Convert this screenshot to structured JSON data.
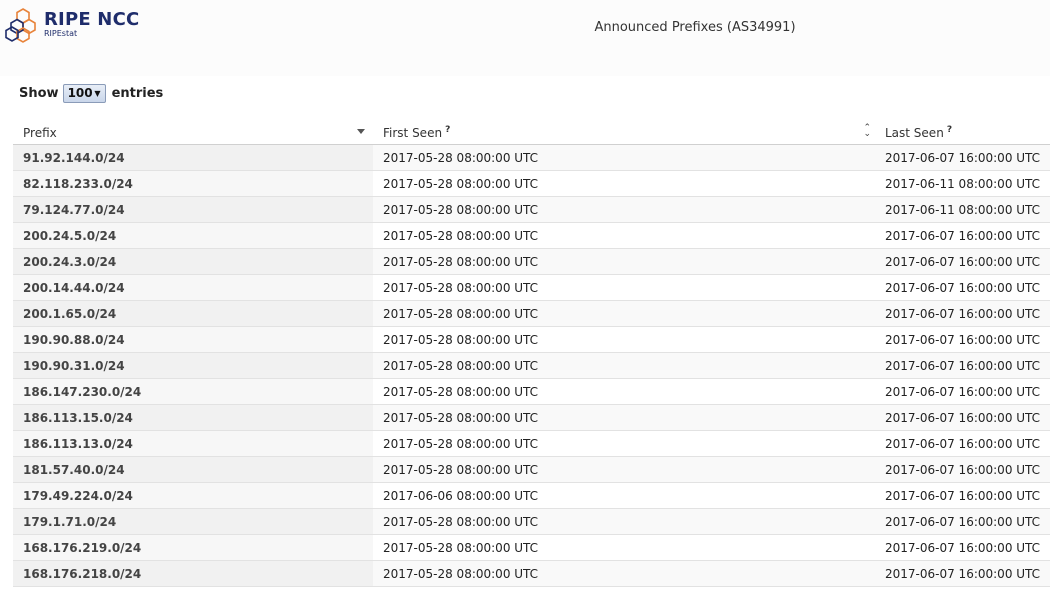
{
  "header": {
    "brand": "RIPE NCC",
    "product": "RIPEstat",
    "widget_title": "Announced Prefixes (AS34991)"
  },
  "length_menu": {
    "show_label": "Show",
    "selected": "100",
    "entries_label": "entries"
  },
  "table": {
    "columns": [
      {
        "label": "Prefix",
        "help": ""
      },
      {
        "label": "First Seen",
        "help": "?"
      },
      {
        "label": "Last Seen",
        "help": "?"
      }
    ],
    "rows": [
      {
        "prefix": "91.92.144.0/24",
        "first_seen": "2017-05-28 08:00:00 UTC",
        "last_seen": "2017-06-07 16:00:00 UTC"
      },
      {
        "prefix": "82.118.233.0/24",
        "first_seen": "2017-05-28 08:00:00 UTC",
        "last_seen": "2017-06-11 08:00:00 UTC"
      },
      {
        "prefix": "79.124.77.0/24",
        "first_seen": "2017-05-28 08:00:00 UTC",
        "last_seen": "2017-06-11 08:00:00 UTC"
      },
      {
        "prefix": "200.24.5.0/24",
        "first_seen": "2017-05-28 08:00:00 UTC",
        "last_seen": "2017-06-07 16:00:00 UTC"
      },
      {
        "prefix": "200.24.3.0/24",
        "first_seen": "2017-05-28 08:00:00 UTC",
        "last_seen": "2017-06-07 16:00:00 UTC"
      },
      {
        "prefix": "200.14.44.0/24",
        "first_seen": "2017-05-28 08:00:00 UTC",
        "last_seen": "2017-06-07 16:00:00 UTC"
      },
      {
        "prefix": "200.1.65.0/24",
        "first_seen": "2017-05-28 08:00:00 UTC",
        "last_seen": "2017-06-07 16:00:00 UTC"
      },
      {
        "prefix": "190.90.88.0/24",
        "first_seen": "2017-05-28 08:00:00 UTC",
        "last_seen": "2017-06-07 16:00:00 UTC"
      },
      {
        "prefix": "190.90.31.0/24",
        "first_seen": "2017-05-28 08:00:00 UTC",
        "last_seen": "2017-06-07 16:00:00 UTC"
      },
      {
        "prefix": "186.147.230.0/24",
        "first_seen": "2017-05-28 08:00:00 UTC",
        "last_seen": "2017-06-07 16:00:00 UTC"
      },
      {
        "prefix": "186.113.15.0/24",
        "first_seen": "2017-05-28 08:00:00 UTC",
        "last_seen": "2017-06-07 16:00:00 UTC"
      },
      {
        "prefix": "186.113.13.0/24",
        "first_seen": "2017-05-28 08:00:00 UTC",
        "last_seen": "2017-06-07 16:00:00 UTC"
      },
      {
        "prefix": "181.57.40.0/24",
        "first_seen": "2017-05-28 08:00:00 UTC",
        "last_seen": "2017-06-07 16:00:00 UTC"
      },
      {
        "prefix": "179.49.224.0/24",
        "first_seen": "2017-06-06 08:00:00 UTC",
        "last_seen": "2017-06-07 16:00:00 UTC"
      },
      {
        "prefix": "179.1.71.0/24",
        "first_seen": "2017-05-28 08:00:00 UTC",
        "last_seen": "2017-06-07 16:00:00 UTC"
      },
      {
        "prefix": "168.176.219.0/24",
        "first_seen": "2017-05-28 08:00:00 UTC",
        "last_seen": "2017-06-07 16:00:00 UTC"
      },
      {
        "prefix": "168.176.218.0/24",
        "first_seen": "2017-05-28 08:00:00 UTC",
        "last_seen": "2017-06-07 16:00:00 UTC"
      }
    ]
  },
  "icons": {
    "logo": "ripe-ncc-hexagon-logo",
    "prefix_sort": "sort-descending-icon",
    "first_seen_sort": "sort-both-icon",
    "select_caret": "caret-down-icon"
  },
  "colors": {
    "brand_navy": "#1f2d6b",
    "brand_orange": "#e8833a",
    "prefix_column_bg": "#f1f1f1"
  }
}
